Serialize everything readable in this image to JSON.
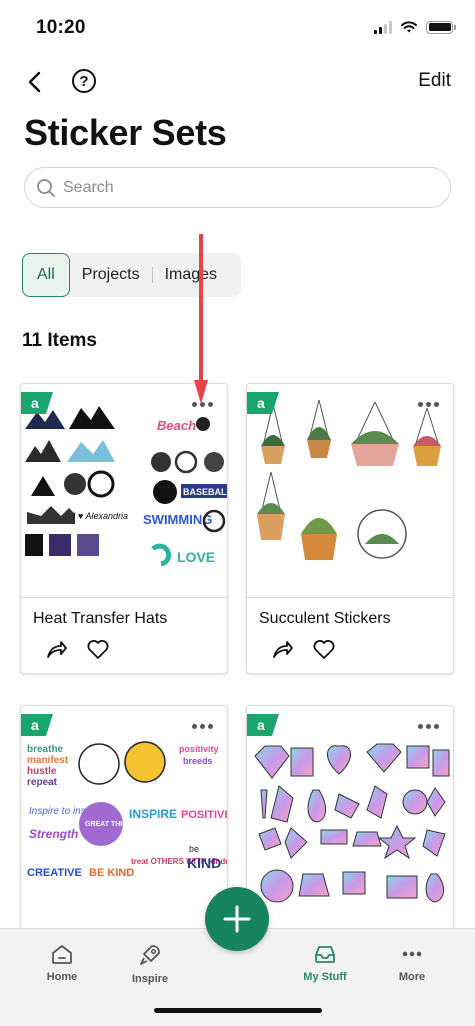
{
  "status_bar": {
    "time": "10:20"
  },
  "nav": {
    "edit_label": "Edit"
  },
  "page_title": "Sticker Sets",
  "search": {
    "placeholder": "Search"
  },
  "filters": [
    {
      "label": "All",
      "active": true
    },
    {
      "label": "Projects",
      "active": false
    },
    {
      "label": "Images",
      "active": false
    }
  ],
  "items_count": "11 Items",
  "cards": [
    {
      "title": "Heat Transfer Hats",
      "badge": "a"
    },
    {
      "title": "Succulent Stickers",
      "badge": "a"
    },
    {
      "title": "",
      "badge": "a"
    },
    {
      "title": "",
      "badge": "a"
    }
  ],
  "sticker_text": {
    "beach": "Beach",
    "alexandria": "I ♥ Alexandria",
    "swimming": "SWIMMING",
    "baseball": "BASEBALL",
    "love": "LOVE",
    "breathe": "breathe",
    "manifest": "manifest",
    "hustle": "hustle",
    "repeat": "repeat",
    "inspire_to_inspire": "Inspire to inspire",
    "strength": "Strength",
    "creative": "CREATIVE",
    "be_kind": "BE KIND",
    "great_things": "GREAT THINGS AWAIT",
    "inspire": "INSPIRE",
    "positivity": "positivity",
    "breeds": "breeds",
    "positive_vibes": "POSITIVE VIBES",
    "treat_others": "treat OTHERS WITH kindness",
    "kind": "KIND",
    "be": "be"
  },
  "tabs": [
    {
      "label": "Home",
      "icon": "home-icon",
      "active": false
    },
    {
      "label": "Inspire",
      "icon": "rocket-icon",
      "active": false
    },
    {
      "label": "My Stuff",
      "icon": "inbox-icon",
      "active": true
    },
    {
      "label": "More",
      "icon": "more-dots-icon",
      "active": false
    }
  ],
  "colors": {
    "accent": "#2b8567",
    "fab": "#17845f",
    "annotation_arrow": "#e8434b"
  }
}
